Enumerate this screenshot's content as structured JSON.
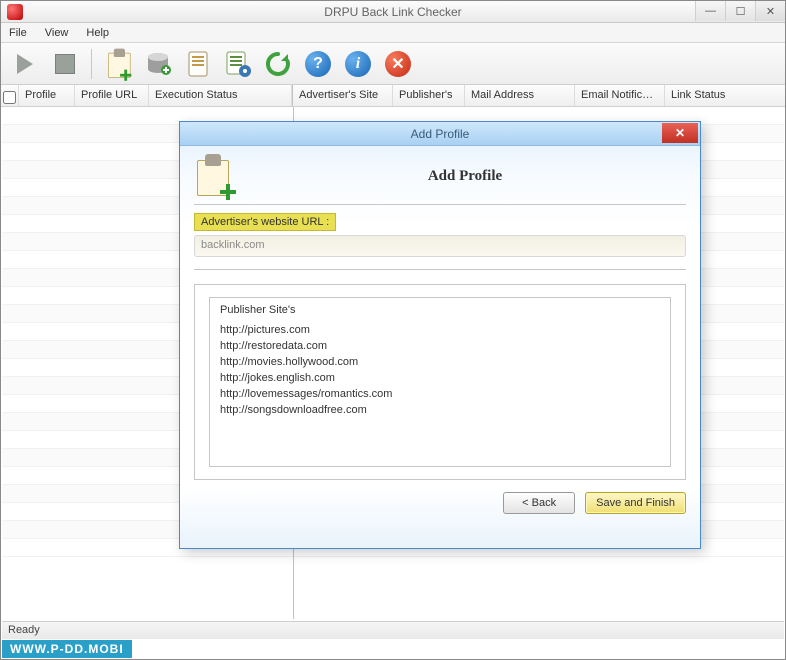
{
  "window": {
    "title": "DRPU Back Link Checker"
  },
  "menu": {
    "file": "File",
    "view": "View",
    "help": "Help"
  },
  "toolbar": {
    "play": "Play",
    "stop": "Stop",
    "add_profile": "Add Profile",
    "db": "Database",
    "report": "Report",
    "tasks": "Tasks",
    "refresh": "Refresh",
    "help": "Help",
    "info": "Info",
    "close": "Close"
  },
  "grid_left": {
    "checkbox": "",
    "profile": "Profile",
    "profile_url": "Profile URL",
    "exec_status": "Execution Status"
  },
  "grid_right": {
    "adv_site": "Advertiser's Site",
    "pub": "Publisher's",
    "mail": "Mail Address",
    "email_notif": "Email Notific…",
    "link_status": "Link Status"
  },
  "status": {
    "ready": "Ready"
  },
  "watermark": "WWW.P-DD.MOBI",
  "dialog": {
    "title": "Add Profile",
    "heading": "Add Profile",
    "adv_label": "Advertiser's website URL :",
    "adv_value": "backlink.com",
    "list_header": "Publisher Site's",
    "sites": [
      "http://pictures.com",
      "http://restoredata.com",
      "http://movies.hollywood.com",
      "http://jokes.english.com",
      "http://lovemessages/romantics.com",
      "http://songsdownloadfree.com"
    ],
    "back": "< Back",
    "save": "Save and Finish"
  }
}
